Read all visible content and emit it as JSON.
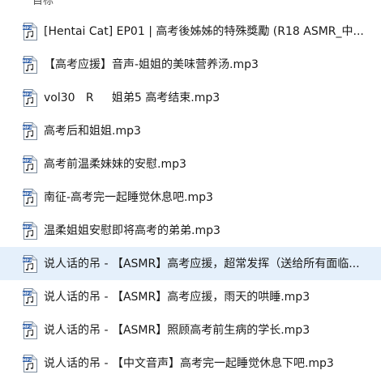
{
  "header_fragment": "目标",
  "files": [
    {
      "name": "[Hentai Cat] EP01 | 高考後姊姊的特殊獎勵 (R18 ASMR_中...",
      "icon": "mp3-file-icon",
      "selected": false
    },
    {
      "name": "【高考应援】音声-姐姐的美味营养汤.mp3",
      "icon": "mp3-file-icon",
      "selected": false
    },
    {
      "name": "vol30   R     姐弟5 高考结束.mp3",
      "icon": "mp3-file-icon",
      "selected": false
    },
    {
      "name": "高考后和姐姐.mp3",
      "icon": "mp3-file-icon",
      "selected": false
    },
    {
      "name": "高考前温柔妹妹的安慰.mp3",
      "icon": "mp3-file-icon",
      "selected": false
    },
    {
      "name": "南征-高考完一起睡觉休息吧.mp3",
      "icon": "mp3-file-icon",
      "selected": false
    },
    {
      "name": "温柔姐姐安慰即将高考的弟弟.mp3",
      "icon": "mp3-file-icon",
      "selected": false
    },
    {
      "name": "说人话的吊 - 【ASMR】高考应援，超常发挥（送给所有面临...",
      "icon": "mp3-file-icon",
      "selected": true
    },
    {
      "name": "说人话的吊 - 【ASMR】高考应援，雨天的哄睡.mp3",
      "icon": "mp3-file-icon",
      "selected": false
    },
    {
      "name": "说人话的吊 - 【ASMR】照顾高考前生病的学长.mp3",
      "icon": "mp3-file-icon",
      "selected": false
    },
    {
      "name": "说人话的吊 - 【中文音声】高考完一起睡觉休息下吧.mp3",
      "icon": "mp3-file-icon",
      "selected": false
    }
  ],
  "icon_label": "MP3",
  "colors": {
    "selected_bg": "#e5f0fb",
    "icon_blue": "#2f5fa8",
    "icon_border": "#7a8a9c"
  }
}
